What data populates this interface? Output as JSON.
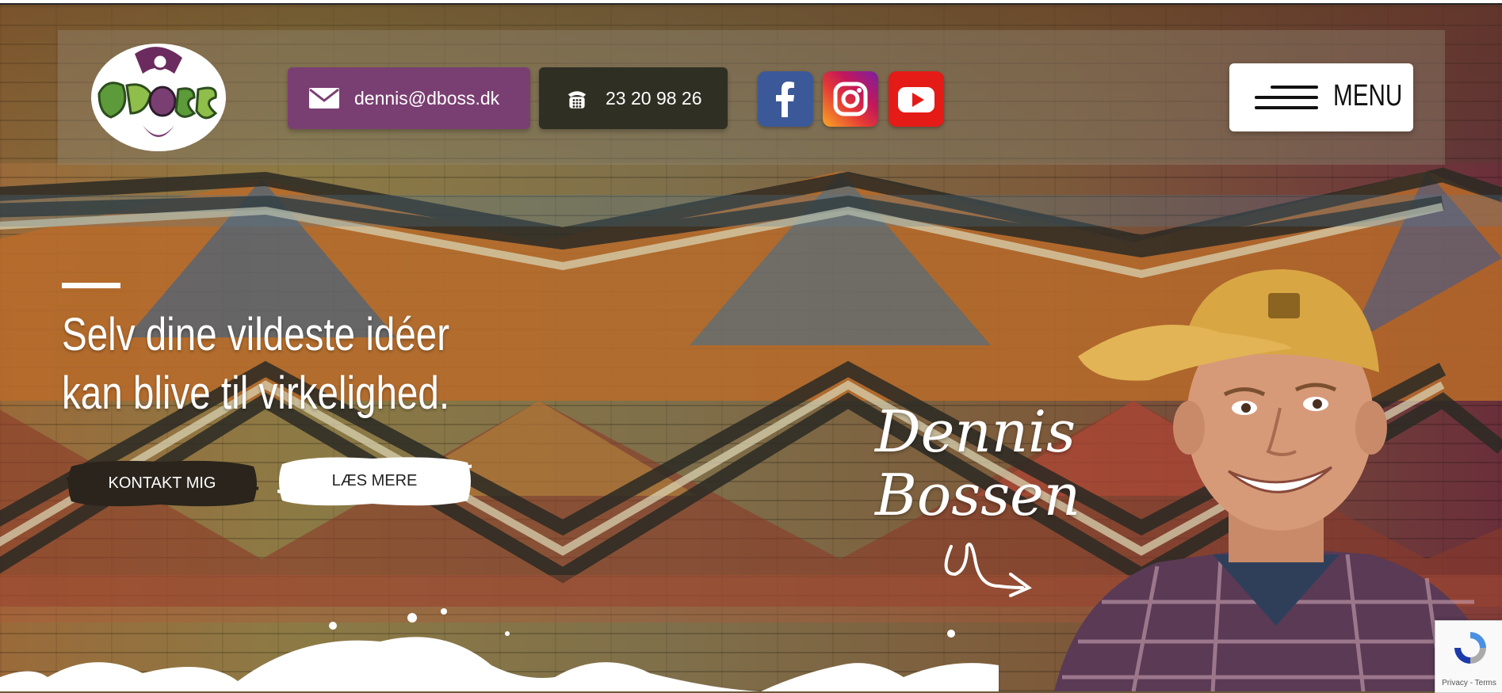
{
  "header": {
    "logo_text": "DBOSS",
    "email_label": "dennis@dboss.dk",
    "phone_label": "23 20 98 26",
    "menu_label": "MENU"
  },
  "social": {
    "facebook": {
      "icon": "facebook-icon",
      "color": "#3b5998"
    },
    "instagram": {
      "icon": "instagram-icon"
    },
    "youtube": {
      "icon": "youtube-icon",
      "color": "#e41b17"
    }
  },
  "hero": {
    "headline_line1": "Selv dine vildeste idéer",
    "headline_line2": "kan blive til virkelighed.",
    "primary_button": "KONTAKT MIG",
    "secondary_button": "LÆS MERE",
    "signature_line1": "Dennis",
    "signature_line2": "Bossen"
  },
  "recaptcha": {
    "footer_text": "Privacy - Terms"
  },
  "colors": {
    "email_pill": "#7a3f72",
    "phone_pill": "#2f2f24",
    "menu_button": "#ffffff"
  }
}
